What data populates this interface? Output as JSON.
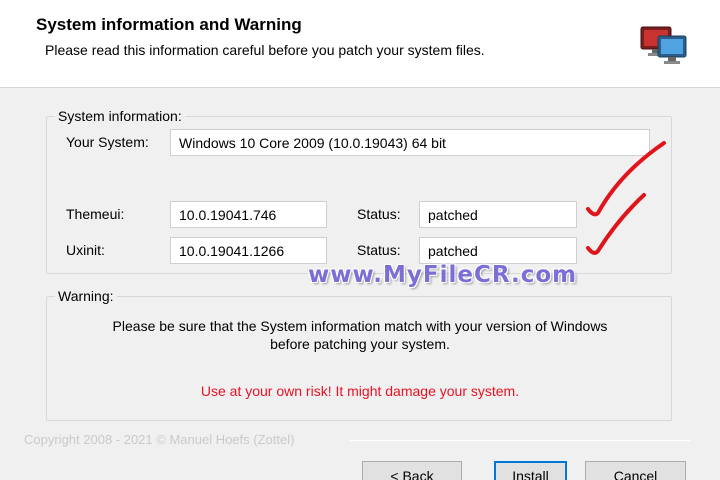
{
  "header": {
    "title": "System information and Warning",
    "subtitle": "Please read this information careful before you patch your system files."
  },
  "sysinfo": {
    "group_label": "System information:",
    "system_label": "Your System:",
    "system_value": "Windows 10 Core 2009 (10.0.19043) 64 bit",
    "themeui_label": "Themeui:",
    "themeui_version": "10.0.19041.746",
    "themeui_status_label": "Status:",
    "themeui_status": "patched",
    "uxinit_label": "Uxinit:",
    "uxinit_version": "10.0.19041.1266",
    "uxinit_status_label": "Status:",
    "uxinit_status": "patched"
  },
  "warning": {
    "group_label": "Warning:",
    "line1": "Please be sure that the System information match with your version of Windows",
    "line2": "before patching your system.",
    "risk": "Use at your own risk! It might damage your system."
  },
  "footer": {
    "copyright": "Copyright 2008 - 2021 © Manuel Hoefs (Zottel)",
    "back_label": "< Back",
    "install_label": "Install",
    "cancel_label": "Cancel"
  },
  "watermark": "www.MyFileCR.com",
  "colors": {
    "risk_text": "#e81123",
    "check_mark": "#e0141b",
    "watermark": "#7b6fd6",
    "default_button_border": "#0078d7"
  },
  "icons": {
    "header": "monitor-icon",
    "annotation": "check-mark-icon"
  }
}
